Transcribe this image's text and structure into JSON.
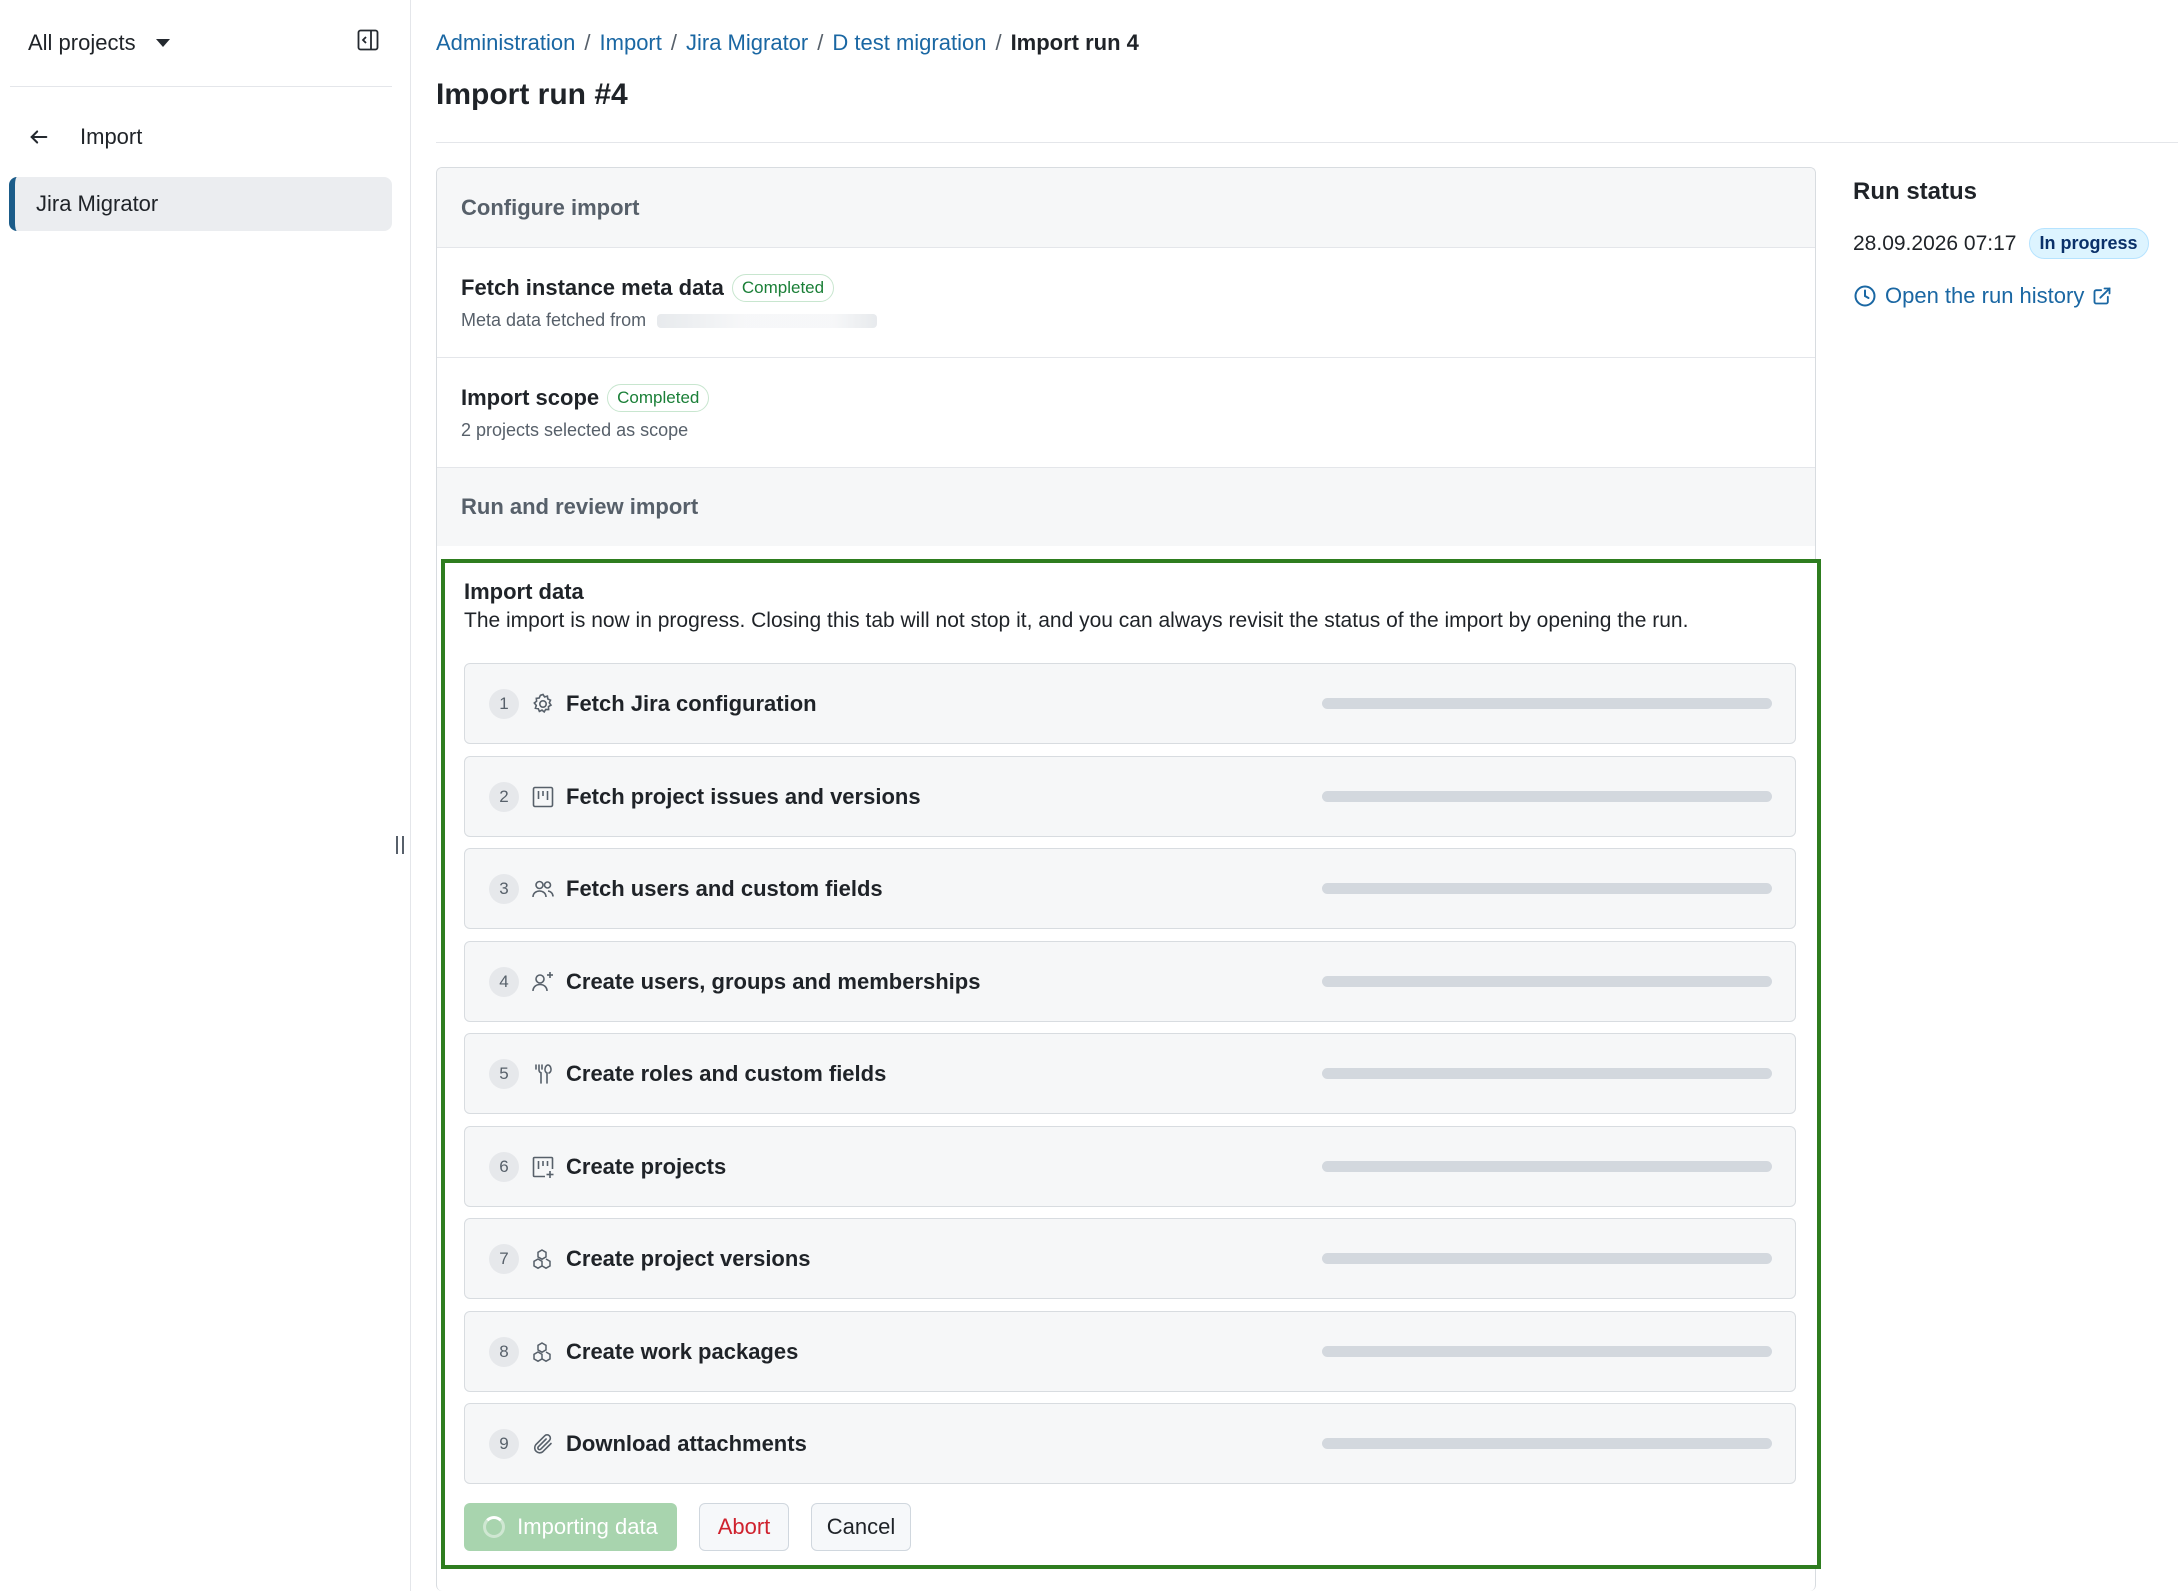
{
  "sidebar": {
    "project_switcher": "All projects",
    "back_label": "Import",
    "active_item": "Jira Migrator"
  },
  "breadcrumb": {
    "items": [
      "Administration",
      "Import",
      "Jira Migrator",
      "D test migration"
    ],
    "current": "Import run 4"
  },
  "page_title": "Import run #4",
  "configure": {
    "heading": "Configure import",
    "fetch_meta": {
      "title": "Fetch instance meta data",
      "status": "Completed",
      "subtitle": "Meta data fetched from"
    },
    "import_scope": {
      "title": "Import scope",
      "status": "Completed",
      "subtitle": "2 projects selected as scope"
    }
  },
  "run_review": {
    "heading": "Run and review import"
  },
  "import_data": {
    "title": "Import data",
    "description": "The import is now in progress. Closing this tab will not stop it, and you can always revisit the status of the import by opening the run.",
    "steps": [
      {
        "num": "1",
        "label": "Fetch Jira configuration",
        "icon": "gear-icon"
      },
      {
        "num": "2",
        "label": "Fetch project issues and versions",
        "icon": "board-icon"
      },
      {
        "num": "3",
        "label": "Fetch users and custom fields",
        "icon": "people-icon"
      },
      {
        "num": "4",
        "label": "Create users, groups and memberships",
        "icon": "person-add-icon"
      },
      {
        "num": "5",
        "label": "Create roles and custom fields",
        "icon": "tools-icon"
      },
      {
        "num": "6",
        "label": "Create projects",
        "icon": "project-add-icon"
      },
      {
        "num": "7",
        "label": "Create project versions",
        "icon": "packages-icon"
      },
      {
        "num": "8",
        "label": "Create work packages",
        "icon": "packages-icon"
      },
      {
        "num": "9",
        "label": "Download attachments",
        "icon": "paperclip-icon"
      }
    ],
    "buttons": {
      "importing": "Importing data",
      "abort": "Abort",
      "cancel": "Cancel"
    }
  },
  "run_status": {
    "title": "Run status",
    "timestamp": "28.09.2026 07:17",
    "status": "In progress",
    "history_link": "Open the run history"
  }
}
